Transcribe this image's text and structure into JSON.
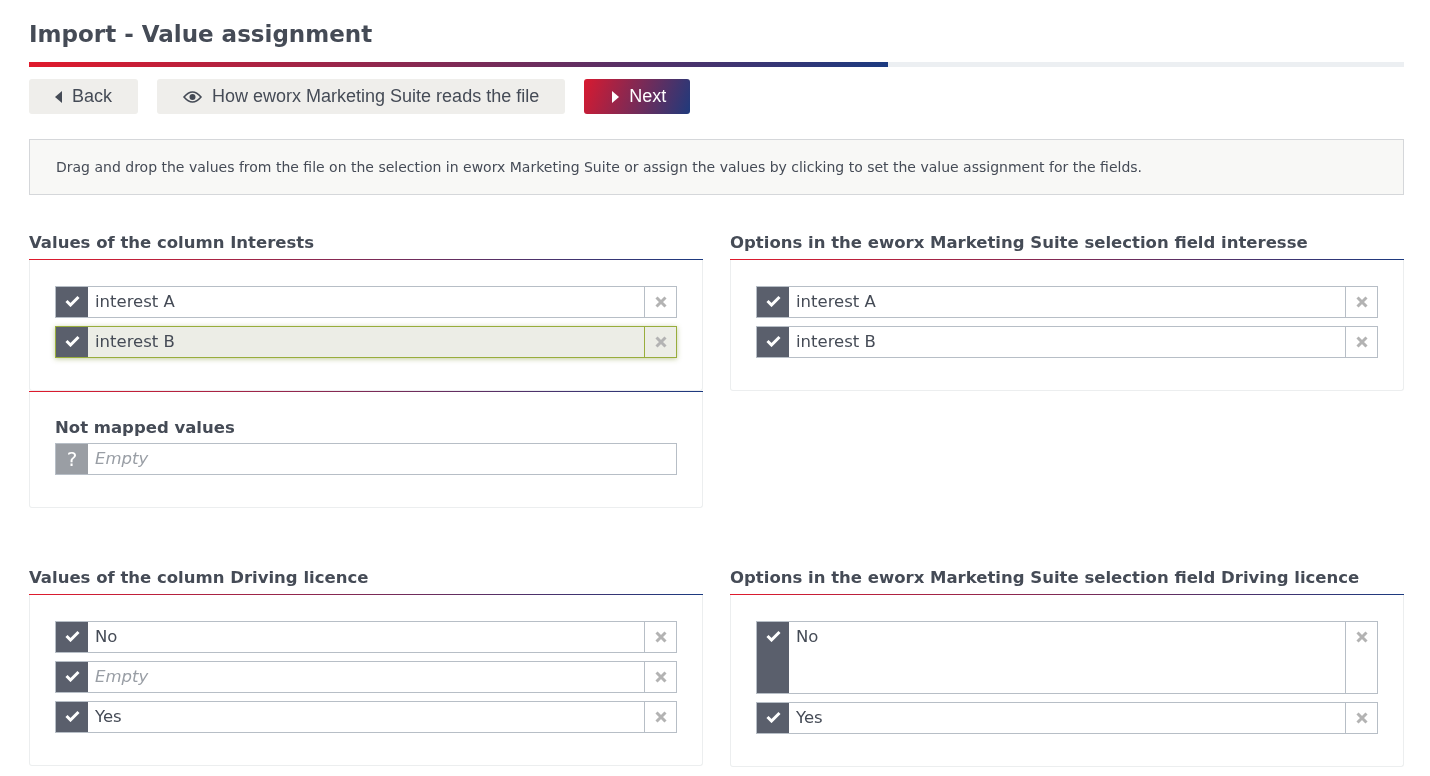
{
  "title": "Import - Value assignment",
  "progress": {
    "level": 0.625
  },
  "buttons": [
    {
      "label": "Back",
      "kind": "back"
    },
    {
      "label": "How eworx Marketing Suite reads the file",
      "kind": "view"
    },
    {
      "label": "Next",
      "kind": "next"
    }
  ],
  "hint": "Drag and drop the values from the file on the selection in eworx Marketing Suite or assign the values by clicking to set the value assignment for the fields.",
  "groups": [
    {
      "source": {
        "heading": "Values of the column Interests",
        "values": [
          {
            "text": "interest A",
            "kind": "mapped",
            "empty": false,
            "selected": false,
            "expanded": false
          },
          {
            "text": "interest B",
            "kind": "mapped",
            "empty": false,
            "selected": true,
            "expanded": false
          }
        ],
        "unmapped": {
          "heading": "Not mapped values",
          "values": [
            {
              "text": "Empty",
              "marker": "?",
              "kind": "unmapped",
              "empty": true,
              "selected": false,
              "expanded": false
            }
          ]
        }
      },
      "target": {
        "heading": "Options in the eworx Marketing Suite selection field interesse",
        "values": [
          {
            "text": "interest A",
            "kind": "mapped",
            "empty": false,
            "selected": false,
            "expanded": false
          },
          {
            "text": "interest B",
            "kind": "mapped",
            "empty": false,
            "selected": false,
            "expanded": false
          }
        ]
      }
    },
    {
      "source": {
        "heading": "Values of the column Driving licence",
        "values": [
          {
            "text": "No",
            "kind": "mapped",
            "empty": false,
            "selected": false,
            "expanded": false
          },
          {
            "text": "Empty",
            "kind": "mapped",
            "empty": true,
            "selected": false,
            "expanded": false
          },
          {
            "text": "Yes",
            "kind": "mapped",
            "empty": false,
            "selected": false,
            "expanded": false
          }
        ]
      },
      "target": {
        "heading": "Options in the eworx Marketing Suite selection field Driving licence",
        "values": [
          {
            "text": "No",
            "kind": "mapped",
            "empty": false,
            "selected": false,
            "expanded": true
          },
          {
            "text": "Yes",
            "kind": "mapped",
            "empty": false,
            "selected": false,
            "expanded": false
          }
        ]
      }
    }
  ]
}
